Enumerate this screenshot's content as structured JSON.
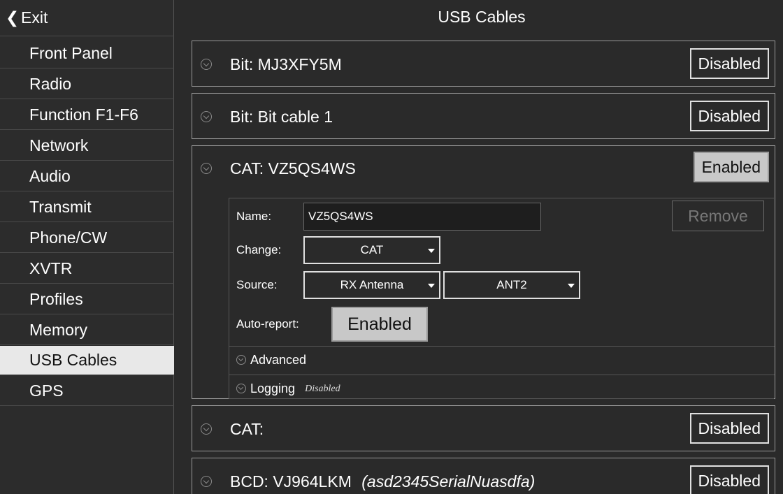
{
  "sidebar": {
    "exit_label": "Exit",
    "items": [
      {
        "label": "Front Panel"
      },
      {
        "label": "Radio"
      },
      {
        "label": "Function F1-F6"
      },
      {
        "label": "Network"
      },
      {
        "label": "Audio"
      },
      {
        "label": "Transmit"
      },
      {
        "label": "Phone/CW"
      },
      {
        "label": "XVTR"
      },
      {
        "label": "Profiles"
      },
      {
        "label": "Memory"
      },
      {
        "label": "USB Cables",
        "selected": true
      },
      {
        "label": "GPS"
      }
    ]
  },
  "page": {
    "title": "USB Cables"
  },
  "cables": [
    {
      "type": "Bit:",
      "name": "MJ3XFY5M",
      "serial": "",
      "state": "Disabled"
    },
    {
      "type": "Bit:",
      "name": "Bit cable 1",
      "serial": "",
      "state": "Disabled"
    },
    {
      "type": "CAT:",
      "name": "VZ5QS4WS",
      "serial": "",
      "state": "Enabled",
      "expanded": true
    },
    {
      "type": "CAT:",
      "name": "",
      "serial": "",
      "state": "Disabled"
    },
    {
      "type": "BCD:",
      "name": "VJ964LKM",
      "serial": "(asd2345SerialNuasdfa)",
      "state": "Disabled"
    }
  ],
  "detail": {
    "name_label": "Name:",
    "name_value": "VZ5QS4WS",
    "remove_label": "Remove",
    "change_label": "Change:",
    "change_value": "CAT",
    "source_label": "Source:",
    "source_value": "RX Antenna",
    "source_port_value": "ANT2",
    "auto_report_label": "Auto-report:",
    "auto_report_value": "Enabled",
    "advanced_label": "Advanced",
    "logging_label": "Logging",
    "logging_state": "Disabled"
  },
  "colors": {
    "background": "#2a2a2a",
    "selected_nav": "#e8e8e8",
    "enabled_button": "#c8c8c8"
  }
}
